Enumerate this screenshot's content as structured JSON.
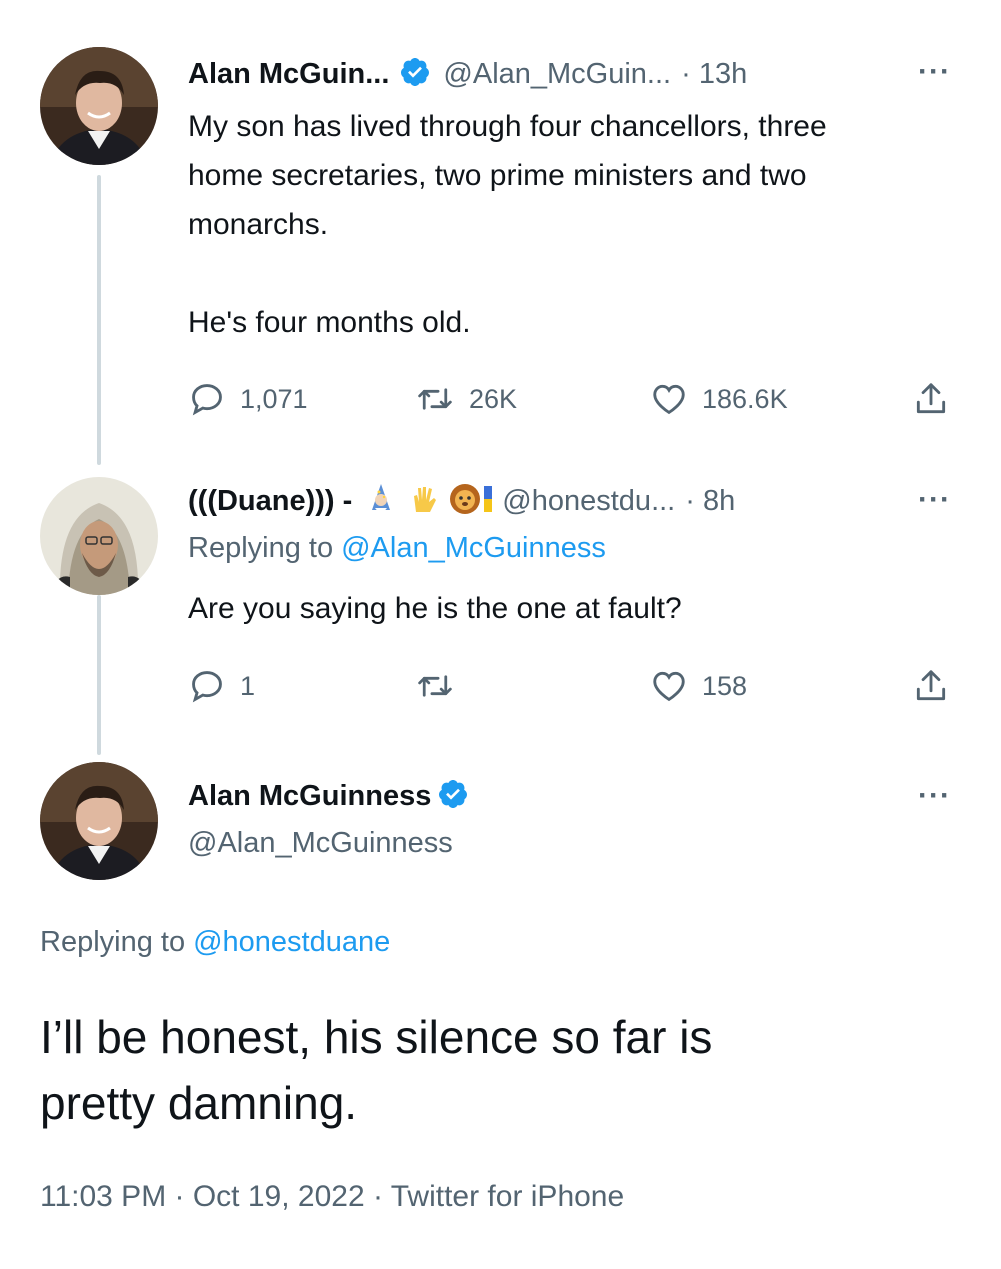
{
  "tweet1": {
    "name": "Alan McGuin...",
    "handle": "@Alan_McGuin...",
    "time": "· 13h",
    "text_lines": [
      "My son has lived through four chancellors, three",
      "home secretaries, two prime ministers and two",
      "monarchs."
    ],
    "text_line2": "He's four months old.",
    "replies": "1,071",
    "retweets": "26K",
    "likes": "186.6K"
  },
  "tweet2": {
    "name": "(((Duane))) -",
    "handle": "@honestdu...",
    "time": "· 8h",
    "replying_prefix": "Replying to",
    "replying_handle": "@Alan_McGuinness",
    "text": "Are you saying he is the one at fault?",
    "replies": "1",
    "retweets": "",
    "likes": "158"
  },
  "tweet3": {
    "name": "Alan McGuinness",
    "handle": "@Alan_McGuinness",
    "replying_prefix": "Replying to",
    "replying_handle": "@honestduane",
    "text_lines": [
      "I’ll be honest, his silence so far is",
      "pretty damning."
    ],
    "meta": "11:03 PM · Oct 19, 2022 · Twitter for iPhone"
  },
  "icons": {
    "more": "more-dots-icon",
    "verified": "verified-badge-icon",
    "reply": "reply-bubble-icon",
    "retweet": "retweet-icon",
    "like": "heart-icon",
    "share": "share-icon"
  },
  "colors": {
    "link": "#1d9bf0",
    "secondary_text": "#536471",
    "thread_line": "#cfd9de"
  }
}
